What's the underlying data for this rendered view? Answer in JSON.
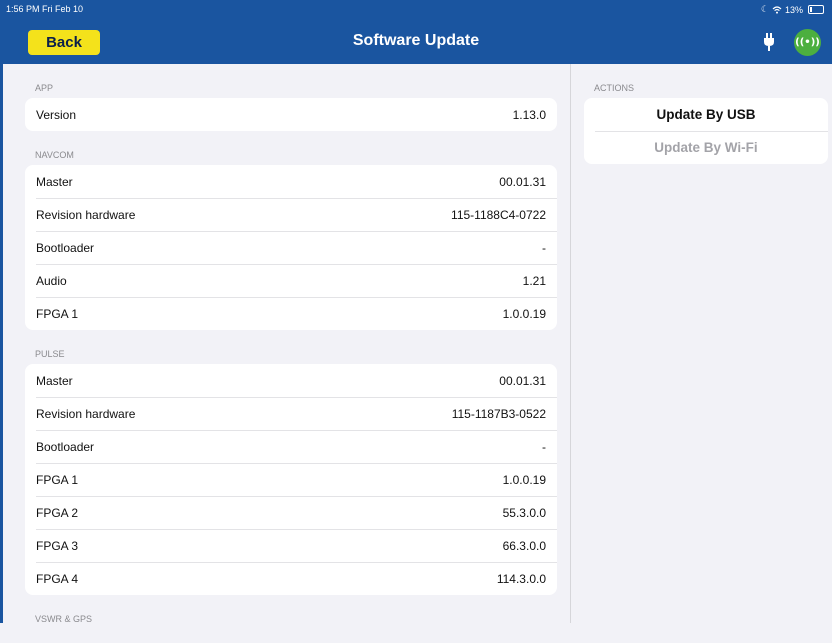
{
  "statusbar": {
    "time": "1:56 PM  Fri Feb 10",
    "battery": "13%",
    "battery_level": 0.13
  },
  "navbar": {
    "back_label": "Back",
    "title": "Software Update",
    "wifi_glyph": "((•))"
  },
  "sections": {
    "app": {
      "header": "APP",
      "rows": [
        {
          "label": "Version",
          "value": "1.13.0"
        }
      ]
    },
    "navcom": {
      "header": "NAVCOM",
      "rows": [
        {
          "label": "Master",
          "value": "00.01.31"
        },
        {
          "label": "Revision hardware",
          "value": "115-1188C4-0722"
        },
        {
          "label": "Bootloader",
          "value": "-"
        },
        {
          "label": "Audio",
          "value": "1.21"
        },
        {
          "label": "FPGA 1",
          "value": "1.0.0.19"
        }
      ]
    },
    "pulse": {
      "header": "PULSE",
      "rows": [
        {
          "label": "Master",
          "value": "00.01.31"
        },
        {
          "label": "Revision hardware",
          "value": "115-1187B3-0522"
        },
        {
          "label": "Bootloader",
          "value": "-"
        },
        {
          "label": "FPGA 1",
          "value": "1.0.0.19"
        },
        {
          "label": "FPGA 2",
          "value": "55.3.0.0"
        },
        {
          "label": "FPGA 3",
          "value": "66.3.0.0"
        },
        {
          "label": "FPGA 4",
          "value": "114.3.0.0"
        }
      ]
    },
    "vswr": {
      "header": "VSWR & GPS"
    }
  },
  "actions": {
    "header": "ACTIONS",
    "update_usb": "Update By USB",
    "update_wifi": "Update By Wi-Fi"
  },
  "colors": {
    "nav_blue": "#1a55a0",
    "back_yellow": "#f4e21b",
    "wifi_green": "#4caf3f",
    "disabled_text": "#a3a3a8"
  },
  "icons": {
    "plug": "plug-icon",
    "wifi": "wifi-antenna-icon",
    "status_wifi": "wifi-icon",
    "status_moon": "moon-icon",
    "battery": "battery-icon"
  }
}
